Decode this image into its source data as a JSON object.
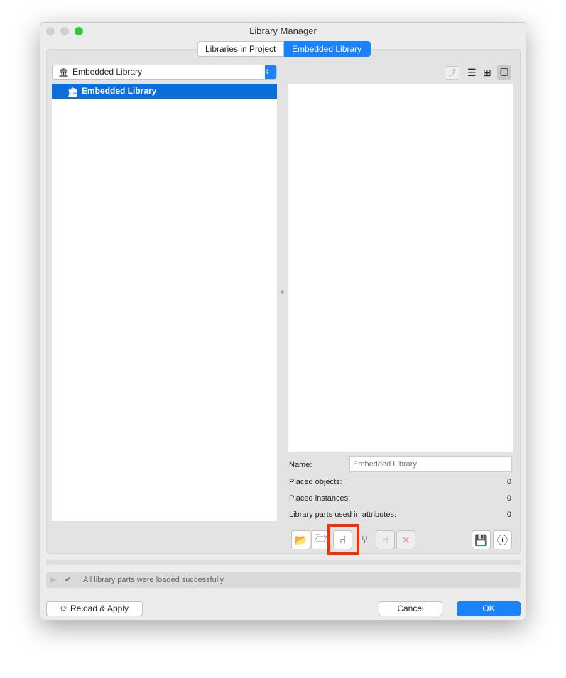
{
  "window": {
    "title": "Library Manager"
  },
  "tabs": [
    {
      "label": "Libraries in Project",
      "active": false
    },
    {
      "label": "Embedded Library",
      "active": true
    }
  ],
  "library_select": {
    "value": "Embedded Library",
    "icon": "library-building-icon"
  },
  "tree": {
    "items": [
      {
        "label": "Embedded Library",
        "selected": true,
        "icon": "library-building-icon"
      }
    ]
  },
  "view_buttons": [
    "folder-up-icon",
    "list-view-icon",
    "grid-view-icon",
    "preview-view-icon"
  ],
  "details": {
    "name_label": "Name:",
    "name_placeholder": "Embedded Library",
    "placed_objects_label": "Placed objects:",
    "placed_objects": "0",
    "placed_instances_label": "Placed instances:",
    "placed_instances": "0",
    "attr_parts_label": "Library parts used in attributes:",
    "attr_parts": "0"
  },
  "toolbar": [
    "new-folder-icon",
    "export-folder-icon",
    "export-object-icon",
    "duplicate-objects-icon",
    "move-object-icon",
    "delete-icon",
    "save-icon",
    "info-icon"
  ],
  "status": {
    "message": "All library parts were loaded successfully"
  },
  "footer": {
    "reload": "Reload & Apply",
    "cancel": "Cancel",
    "ok": "OK"
  },
  "colors": {
    "accent": "#0a6fdb",
    "highlight": "#ff2a00"
  }
}
